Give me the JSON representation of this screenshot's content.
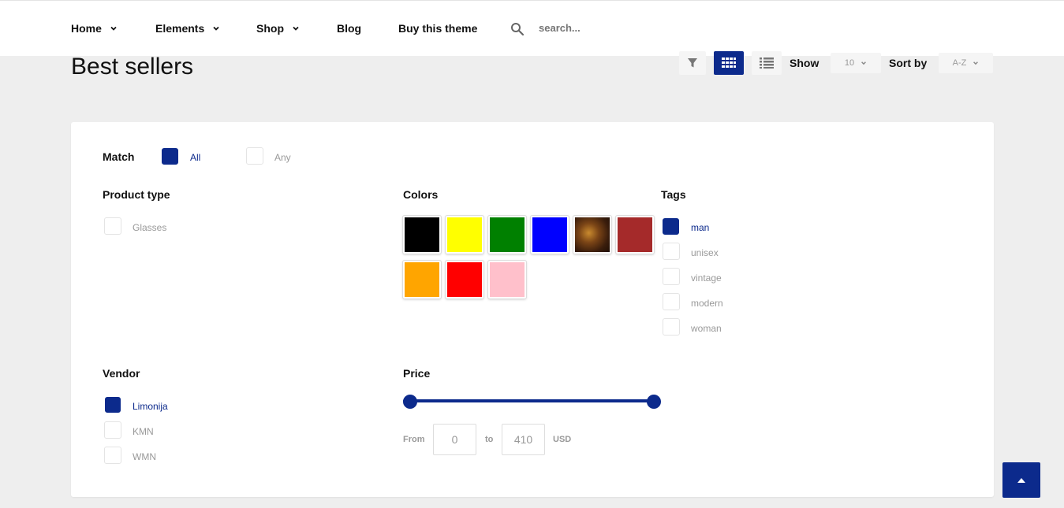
{
  "nav": {
    "items": [
      {
        "label": "Home",
        "dropdown": true
      },
      {
        "label": "Elements",
        "dropdown": true
      },
      {
        "label": "Shop",
        "dropdown": true
      },
      {
        "label": "Blog",
        "dropdown": false
      },
      {
        "label": "Buy this theme",
        "dropdown": false
      }
    ],
    "search_placeholder": "search..."
  },
  "page": {
    "title": "Best sellers"
  },
  "toolbar": {
    "show_label": "Show",
    "show_value": "10",
    "sort_label": "Sort by",
    "sort_value": "A-Z"
  },
  "filters": {
    "match": {
      "label": "Match",
      "options": [
        {
          "label": "All",
          "checked": true
        },
        {
          "label": "Any",
          "checked": false
        }
      ]
    },
    "product_type": {
      "title": "Product type",
      "options": [
        {
          "label": "Glasses",
          "checked": false
        }
      ]
    },
    "colors": {
      "title": "Colors",
      "swatches": [
        "#000000",
        "#ffff00",
        "#008000",
        "#0000ff",
        "tortoise",
        "#a52a2a",
        "#ffa500",
        "#ff0000",
        "#ffc0cb"
      ]
    },
    "tags": {
      "title": "Tags",
      "options": [
        {
          "label": "man",
          "checked": true
        },
        {
          "label": "unisex",
          "checked": false
        },
        {
          "label": "vintage",
          "checked": false
        },
        {
          "label": "modern",
          "checked": false
        },
        {
          "label": "woman",
          "checked": false
        }
      ]
    },
    "vendor": {
      "title": "Vendor",
      "options": [
        {
          "label": "Limonija",
          "checked": true
        },
        {
          "label": "KMN",
          "checked": false
        },
        {
          "label": "WMN",
          "checked": false
        }
      ]
    },
    "price": {
      "title": "Price",
      "from_label": "From",
      "from_value": "0",
      "to_label": "to",
      "to_value": "410",
      "currency": "USD"
    }
  },
  "colors": {
    "accent": "#0c2a8c",
    "background": "#eeeeee"
  }
}
